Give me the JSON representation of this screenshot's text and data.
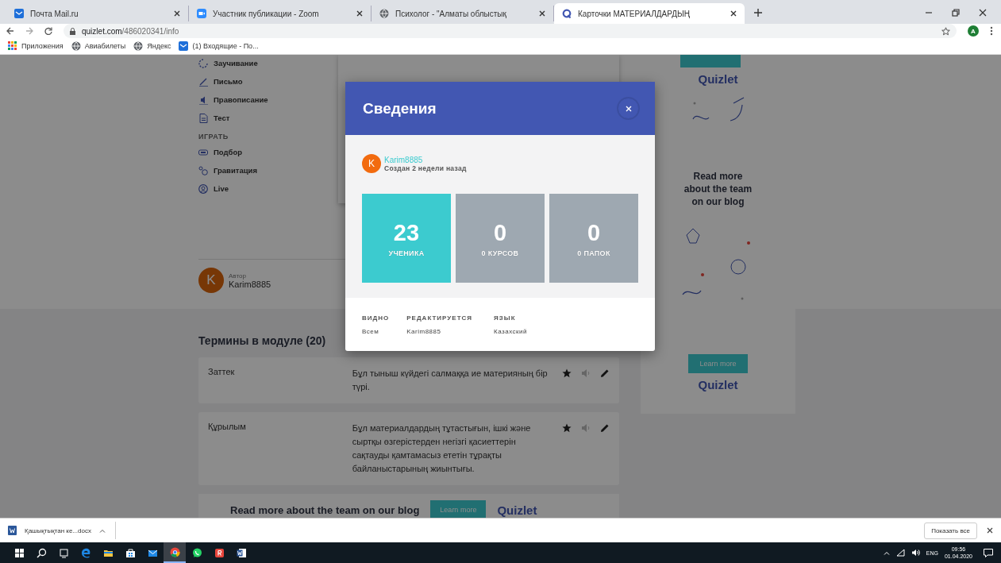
{
  "browser": {
    "tabs": [
      {
        "kind": "mail",
        "title": "Почта Mail.ru",
        "selected": false
      },
      {
        "kind": "video",
        "title": "Участник публикации - Zoom",
        "selected": false
      },
      {
        "kind": "web",
        "title": "Психолог - \"Алматы облыстық",
        "selected": false
      },
      {
        "kind": "app",
        "title": "Карточки МАТЕРИАЛДАРДЫҢ",
        "selected": true
      }
    ],
    "address": {
      "host": "quizlet.com",
      "path": "/486020341/info"
    },
    "profile_initial": "A",
    "bookmarks": [
      {
        "kind": "apps",
        "label": "Приложения"
      },
      {
        "kind": "web",
        "label": "Авиабилеты"
      },
      {
        "kind": "web",
        "label": "Яндекс"
      },
      {
        "kind": "mail",
        "label": "(1) Входящие - По..."
      }
    ]
  },
  "sidebar": {
    "study": [
      {
        "kind": "learn",
        "label": "Заучивание"
      },
      {
        "kind": "write",
        "label": "Письмо"
      },
      {
        "kind": "spell",
        "label": "Правописание"
      },
      {
        "kind": "test",
        "label": "Тест"
      }
    ],
    "play_heading": "ИГРАТЬ",
    "play": [
      {
        "kind": "match",
        "label": "Подбор"
      },
      {
        "kind": "gravity",
        "label": "Гравитация"
      },
      {
        "kind": "live",
        "label": "Live"
      }
    ]
  },
  "author": {
    "initial": "K",
    "caption": "Автор",
    "name": "Karim8885"
  },
  "terms": {
    "heading": "Термины в модуле (20)",
    "rows": [
      {
        "term": "Заттек",
        "definition": "Бұл тыныш күйдегі салмаққа ие материяның бір түрі."
      },
      {
        "term": "Құрылым",
        "definition": "Бұл материалдардың тұтастығын, ішкі және сыртқы өзгерістерден негізгі қасиеттерін сақтауды қамтамасыз ететін тұрақты байланыстарының жиынтығы."
      }
    ]
  },
  "banner": {
    "text": "Read more about the team on our blog",
    "button": "Learn more",
    "logo": "Quizlet"
  },
  "side_ad": {
    "logo_top": "Quizlet",
    "text": "Read more about the team on our blog",
    "button": "Learn more",
    "logo_bottom": "Quizlet"
  },
  "modal": {
    "title": "Сведения",
    "author_initial": "K",
    "author": "Karim8885",
    "created": "Создан 2 недели назад",
    "stats": [
      {
        "value": "23",
        "label": "УЧЕНИКА",
        "color": "#3ccbcf"
      },
      {
        "value": "0",
        "label": "0 КУРСОВ",
        "color": "#9ea8b1"
      },
      {
        "value": "0",
        "label": "0 ПАПОК",
        "color": "#9ea8b1"
      }
    ],
    "details": [
      {
        "label": "ВИДНО",
        "value": "Всем"
      },
      {
        "label": "РЕДАКТИРУЕТСЯ",
        "value": "Karim8885"
      },
      {
        "label": "ЯЗЫК",
        "value": "Казахский"
      }
    ]
  },
  "downloads": {
    "file": "Қашықтықтан ке...docx",
    "show_all": "Показать все"
  },
  "taskbar": {
    "language": "ENG",
    "time": "09:56",
    "date": "01.04.2020"
  }
}
